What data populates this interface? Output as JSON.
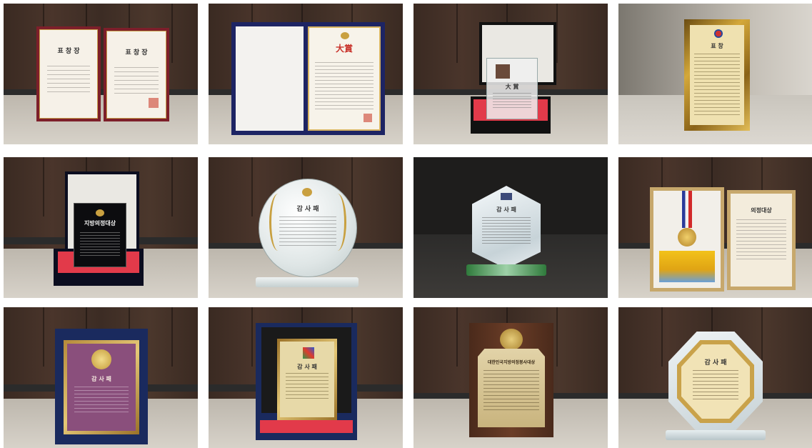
{
  "tiles": [
    {
      "type": "certificate-pair",
      "title_left": "표 창 장",
      "title_right": "표 창 장",
      "colors": {
        "frame": "#7d1f2a",
        "paper": "#f6f1e8"
      }
    },
    {
      "type": "certificate-folder",
      "heading": "大賞",
      "colors": {
        "folder": "#1d2463",
        "paper": "#f7f3ea"
      }
    },
    {
      "type": "acrylic-in-box",
      "heading": "大 賞",
      "colors": {
        "box": "#111111",
        "lining": "#e23a4a"
      }
    },
    {
      "type": "gold-plaque",
      "heading": "표 창",
      "colors": {
        "frame": "#c79a2c"
      }
    },
    {
      "type": "black-plaque-in-box",
      "heading": "지방의정대상",
      "colors": {
        "box": "#0b0d1f",
        "lining": "#e23a4a"
      }
    },
    {
      "type": "round-crystal",
      "heading": "감 사 패",
      "colors": {
        "crystal": "#e8ecec",
        "ornament": "#c8a040"
      }
    },
    {
      "type": "crystal-shield",
      "heading": "감 사 패",
      "colors": {
        "crystal": "#d9e2e6"
      }
    },
    {
      "type": "medal-certificate",
      "heading": "의정대상",
      "colors": {
        "frame": "#c7a86c",
        "ribbon": "#2a3a9a"
      }
    },
    {
      "type": "purple-plaque-in-box",
      "heading": "감 사 패",
      "colors": {
        "box": "#1a2a5e",
        "plaque": "#8a4f7c"
      }
    },
    {
      "type": "gold-plaque-in-box",
      "heading": "감 사 패",
      "colors": {
        "box": "#1a2a5e",
        "plaque": "#d9c38a"
      }
    },
    {
      "type": "wood-plaque",
      "heading": "대한민국지방의정봉사대상",
      "colors": {
        "wood": "#5a3322",
        "plate": "#d7c59a"
      }
    },
    {
      "type": "octagon-crystal",
      "heading": "감 사 패",
      "colors": {
        "plate": "#c9a24a"
      }
    }
  ]
}
